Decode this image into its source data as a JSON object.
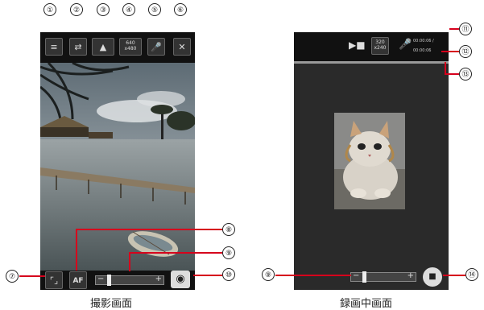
{
  "callouts": [
    "①",
    "②",
    "③",
    "④",
    "⑤",
    "⑥",
    "⑦",
    "⑧",
    "⑨",
    "⑩",
    "⑪",
    "⑫",
    "⑬",
    "⑭"
  ],
  "left": {
    "caption": "撮影画面",
    "res_label": "640\nx480",
    "af_label": "AF",
    "zoom_minus": "−",
    "zoom_plus": "+"
  },
  "right": {
    "caption": "録画中画面",
    "res_label": "320\nx240",
    "time1": "00:00:06 / ",
    "time2": "00:00:06",
    "zoom_minus": "−",
    "zoom_plus": "+"
  }
}
